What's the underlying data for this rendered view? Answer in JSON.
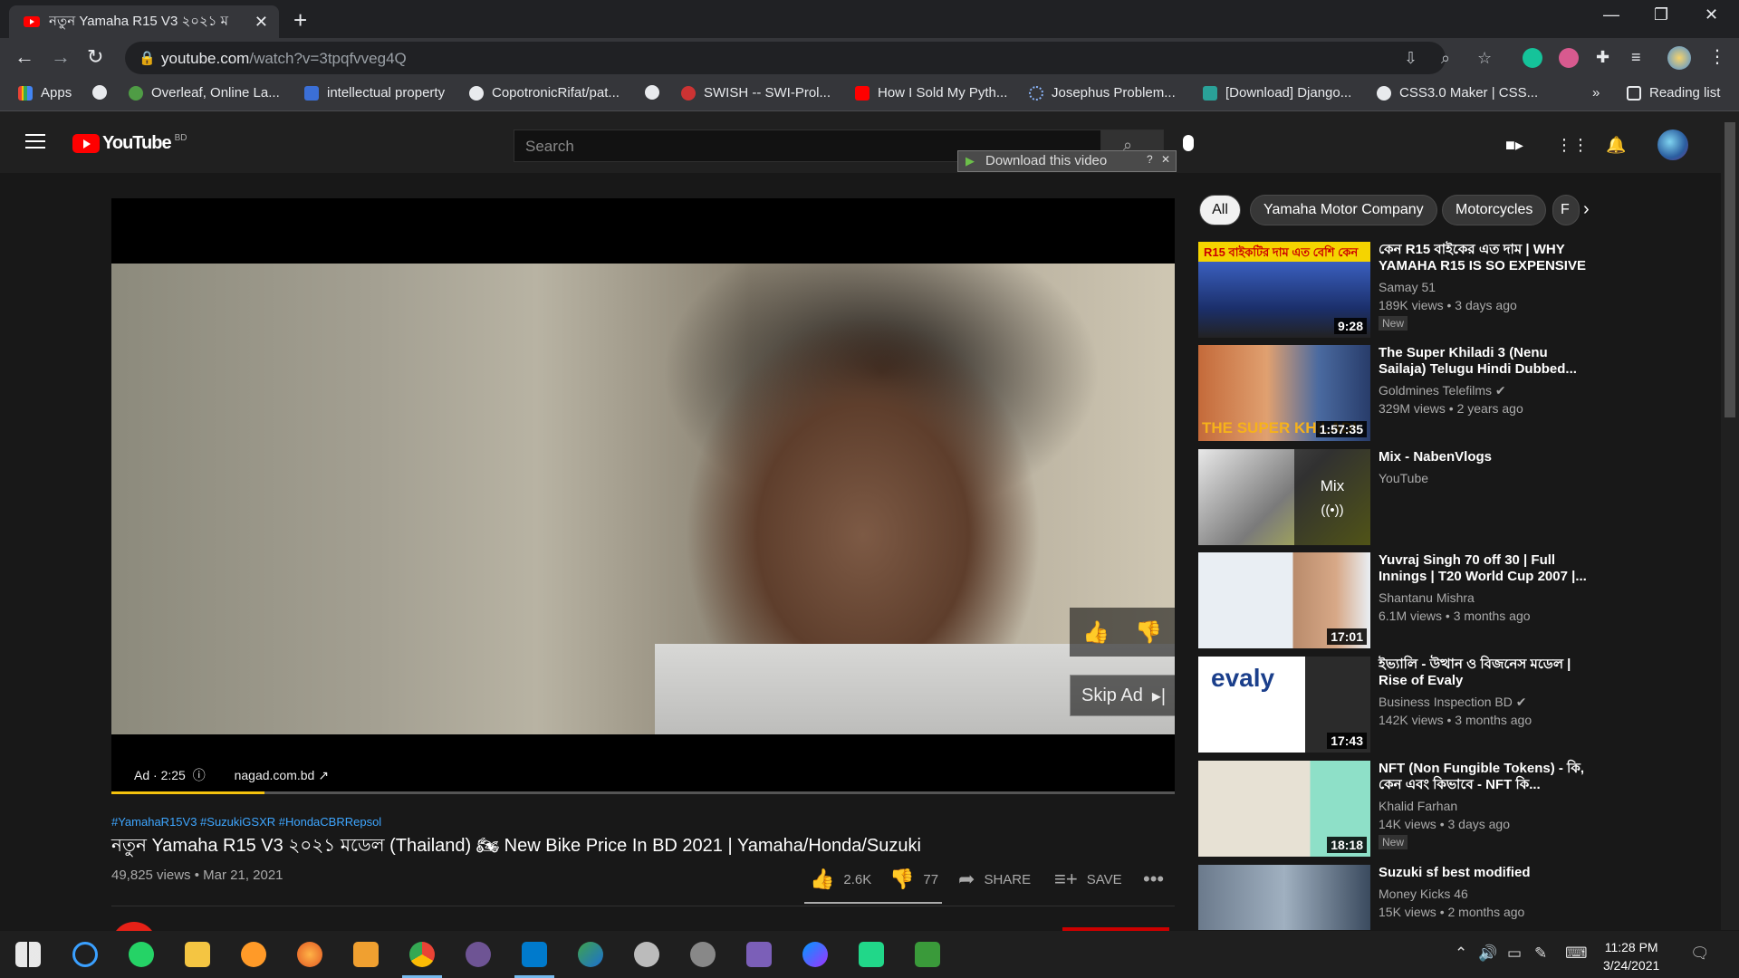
{
  "browser": {
    "tab_title": "নতুন Yamaha R15 V3 ২০২১ ম",
    "url_host": "youtube.com",
    "url_path": "/watch?v=3tpqfvveg4Q",
    "bookmarks": [
      "Apps",
      "Overleaf, Online La...",
      "intellectual property",
      "CopotronicRifat/pat...",
      "SWISH -- SWI-Prol...",
      "How I Sold My Pyth...",
      "Josephus Problem...",
      "[Download] Django...",
      "CSS3.0 Maker | CSS..."
    ],
    "reading_list": "Reading list",
    "overflow": "»"
  },
  "youtube": {
    "logo_word": "YouTube",
    "country": "BD",
    "search_placeholder": "Search",
    "download_label": "Download this video"
  },
  "player": {
    "ad_label": "Ad · 2:25",
    "ad_domain": "nagad.com.bd",
    "skip_label": "Skip Ad",
    "progress": 0.144
  },
  "video": {
    "hashtags": "#YamahaR15V3 #SuzukiGSXR #HondaCBRRepsol",
    "title": "নতুন Yamaha R15 V3 ২০২১ মডেল (Thailand) 🏍 New Bike Price In BD 2021 | Yamaha/Honda/Suzuki",
    "views": "49,825 views • Mar 21, 2021",
    "likes": "2.6K",
    "dislikes": "77",
    "share": "SHARE",
    "save": "SAVE"
  },
  "chips": [
    "All",
    "Yamaha Motor Company",
    "Motorcycles",
    "F"
  ],
  "recommendations": [
    {
      "title": "কেন R15 বাইকের এত দাম | WHY YAMAHA R15 IS SO EXPENSIVE",
      "channel": "Samay 51",
      "meta": "189K views • 3 days ago",
      "duration": "9:28",
      "badge": "New",
      "thumb_text": "R15 বাইকটির দাম এত বেশি কেন"
    },
    {
      "title": "The Super Khiladi 3 (Nenu Sailaja) Telugu Hindi Dubbed...",
      "channel": "Goldmines Telefilms",
      "meta": "329M views • 2 years ago",
      "duration": "1:57:35",
      "thumb_text": "THE SUPER KHILADI"
    },
    {
      "title": "Mix - NabenVlogs",
      "channel": "YouTube",
      "meta": "",
      "mix_label": "Mix",
      "mix_icon": "((•))"
    },
    {
      "title": "Yuvraj Singh 70 off 30 | Full Innings | T20 World Cup 2007 |...",
      "channel": "Shantanu Mishra",
      "meta": "6.1M views • 3 months ago",
      "duration": "17:01"
    },
    {
      "title": "ইভ্যালি - উত্থান ও বিজনেস মডেল | Rise of Evaly",
      "channel": "Business Inspection BD",
      "meta": "142K views • 3 months ago",
      "duration": "17:43",
      "thumb_text": "evaly"
    },
    {
      "title": "NFT (Non Fungible Tokens) - কি, কেন এবং কিভাবে - NFT কি...",
      "channel": "Khalid Farhan",
      "meta": "14K views • 3 days ago",
      "duration": "18:18",
      "badge": "New"
    },
    {
      "title": "Suzuki sf best modified",
      "channel": "Money Kicks 46",
      "meta": "15K views • 2 months ago"
    }
  ],
  "taskbar": {
    "time": "11:28 PM",
    "date": "3/24/2021"
  }
}
